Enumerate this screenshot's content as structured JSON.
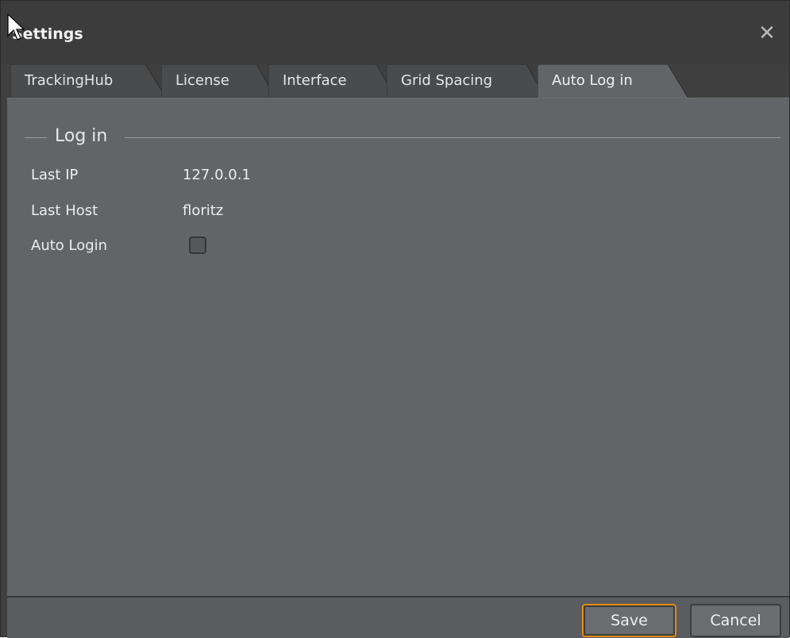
{
  "window": {
    "title": "Settings",
    "close_glyph": "✕"
  },
  "tabs": [
    {
      "label": "TrackingHub",
      "active": false
    },
    {
      "label": "License",
      "active": false
    },
    {
      "label": "Interface",
      "active": false
    },
    {
      "label": "Grid Spacing",
      "active": false
    },
    {
      "label": "Auto Log in",
      "active": true
    }
  ],
  "group": {
    "title": "Log in",
    "rows": [
      {
        "label": "Last IP",
        "value": "127.0.0.1"
      },
      {
        "label": "Last Host",
        "value": "floritz"
      },
      {
        "label": "Auto Login",
        "checked": false
      }
    ]
  },
  "footer": {
    "save_label": "Save",
    "cancel_label": "Cancel"
  },
  "colors": {
    "accent": "#e58a14",
    "panel": "#626568",
    "chrome": "#3f3f3f"
  },
  "icons": {
    "close": "close-icon",
    "cursor": "mouse-pointer-icon"
  }
}
